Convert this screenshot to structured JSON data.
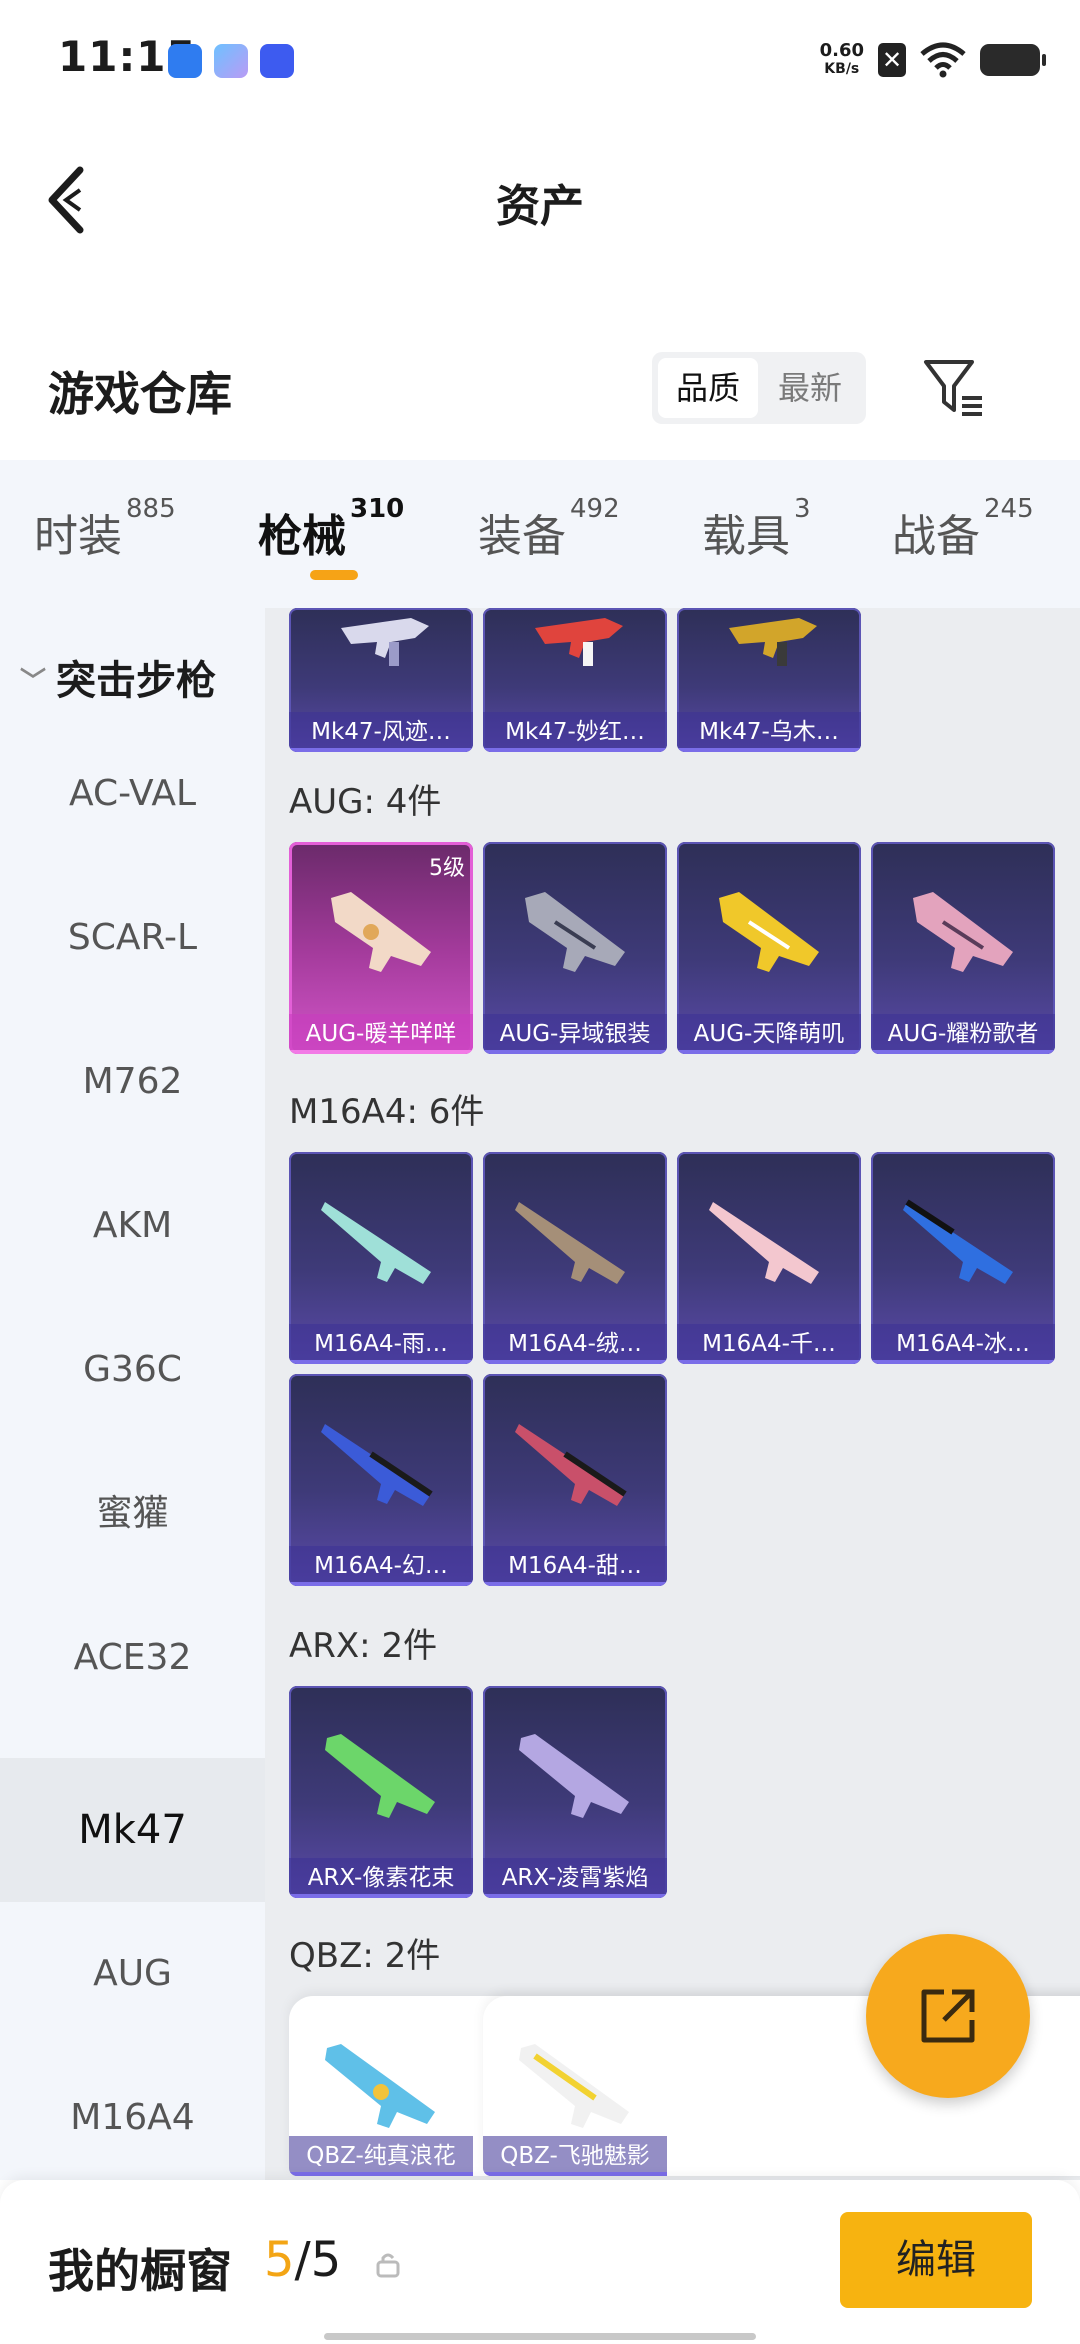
{
  "status_bar": {
    "time": "11:15",
    "net_speed_value": "0.60",
    "net_speed_unit": "KB/s"
  },
  "header": {
    "title": "资产"
  },
  "warehouse": {
    "title": "游戏仓库",
    "sort_options": [
      "品质",
      "最新"
    ],
    "active_sort": "品质"
  },
  "tabs": [
    {
      "label": "时装",
      "count": "885"
    },
    {
      "label": "枪械",
      "count": "310"
    },
    {
      "label": "装备",
      "count": "492"
    },
    {
      "label": "载具",
      "count": "3"
    },
    {
      "label": "战备",
      "count": "245"
    }
  ],
  "active_tab": "枪械",
  "sidebar": {
    "category": "突击步枪",
    "items": [
      "AC-VAL",
      "SCAR-L",
      "M762",
      "AKM",
      "G36C",
      "蜜獾",
      "ACE32",
      "Mk47",
      "AUG",
      "M16A4"
    ],
    "active": "Mk47"
  },
  "groups": [
    {
      "title": "",
      "items": [
        {
          "name": "Mk47-风迹…"
        },
        {
          "name": "Mk47-妙红…"
        },
        {
          "name": "Mk47-乌木…"
        }
      ]
    },
    {
      "title": "AUG: 4件",
      "items": [
        {
          "name": "AUG-暖羊咩咩",
          "level": "5级"
        },
        {
          "name": "AUG-异域银装"
        },
        {
          "name": "AUG-天降萌叽"
        },
        {
          "name": "AUG-耀粉歌者"
        }
      ]
    },
    {
      "title": "M16A4: 6件",
      "items": [
        {
          "name": "M16A4-雨…"
        },
        {
          "name": "M16A4-绒…"
        },
        {
          "name": "M16A4-千…"
        },
        {
          "name": "M16A4-冰…"
        },
        {
          "name": "M16A4-幻…"
        },
        {
          "name": "M16A4-甜…"
        }
      ]
    },
    {
      "title": "ARX: 2件",
      "items": [
        {
          "name": "ARX-像素花束"
        },
        {
          "name": "ARX-凌霄紫焰"
        }
      ]
    },
    {
      "title": "QBZ: 2件",
      "items": [
        {
          "name": "QBZ-纯真浪花"
        },
        {
          "name": "QBZ-飞驰魅影"
        }
      ]
    }
  ],
  "bottom": {
    "label": "我的橱窗",
    "current": "5",
    "sep": "/",
    "total": "5",
    "edit_label": "编辑"
  }
}
